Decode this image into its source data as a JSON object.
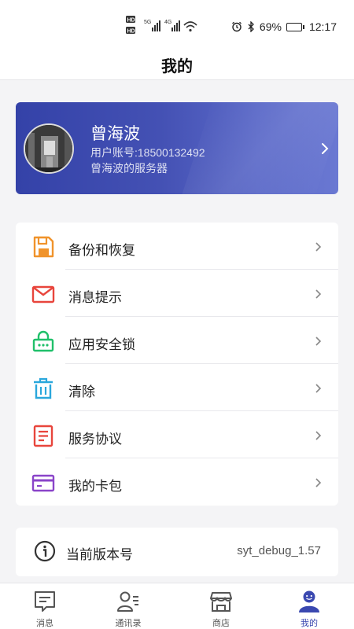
{
  "status_bar": {
    "sim1": "HD",
    "sim2": "HD",
    "net1": "5G",
    "net2": "4G",
    "battery": "69%",
    "battery_level": 0.69,
    "time": "12:17"
  },
  "header": {
    "title": "我的"
  },
  "profile": {
    "name": "曾海波",
    "account": "用户账号:18500132492",
    "server": "曾海波的服务器"
  },
  "menu": {
    "items": [
      {
        "label": "备份和恢复",
        "icon": "backup-icon",
        "color": "#f0932b"
      },
      {
        "label": "消息提示",
        "icon": "mail-icon",
        "color": "#e8453c"
      },
      {
        "label": "应用安全锁",
        "icon": "lock-icon",
        "color": "#20c06a"
      },
      {
        "label": "清除",
        "icon": "trash-icon",
        "color": "#2aa7dc"
      },
      {
        "label": "服务协议",
        "icon": "document-icon",
        "color": "#e8453c"
      },
      {
        "label": "我的卡包",
        "icon": "card-icon",
        "color": "#8a44c9"
      }
    ]
  },
  "version": {
    "label": "当前版本号",
    "value": "syt_debug_1.57"
  },
  "tabs": [
    {
      "label": "消息",
      "icon": "message-icon"
    },
    {
      "label": "通讯录",
      "icon": "contacts-icon"
    },
    {
      "label": "商店",
      "icon": "store-icon"
    },
    {
      "label": "我的",
      "icon": "profile-icon",
      "active": true
    }
  ],
  "colors": {
    "accent": "#3a48b0",
    "card_gradient_start": "#3442a8",
    "card_gradient_end": "#6a78d2"
  }
}
